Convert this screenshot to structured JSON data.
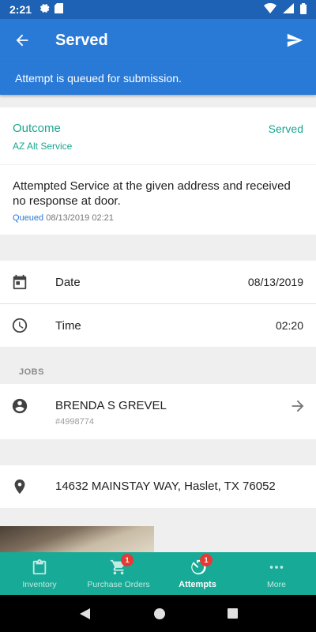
{
  "status_bar": {
    "time": "2:21"
  },
  "app_bar": {
    "title": "Served"
  },
  "banner": {
    "text": "Attempt is queued for submission."
  },
  "outcome": {
    "label": "Outcome",
    "sub": "AZ Alt Service",
    "value": "Served"
  },
  "description": {
    "text": "Attempted Service at the given address and received no response at door.",
    "status": "Queued",
    "timestamp": "08/13/2019 02:21"
  },
  "date_row": {
    "label": "Date",
    "value": "08/13/2019"
  },
  "time_row": {
    "label": "Time",
    "value": "02:20"
  },
  "jobs": {
    "header": "JOBS",
    "name": "BRENDA S GREVEL",
    "id": "#4998774"
  },
  "address": {
    "text": "14632 MAINSTAY WAY, Haslet, TX 76052"
  },
  "bottom_nav": {
    "items": [
      {
        "label": "Inventory",
        "icon": "clipboard-icon"
      },
      {
        "label": "Purchase Orders",
        "icon": "cart-icon",
        "badge": "1"
      },
      {
        "label": "Attempts",
        "icon": "timer-icon",
        "badge": "1",
        "active": true
      },
      {
        "label": "More",
        "icon": "more-icon"
      }
    ]
  },
  "colors": {
    "primary": "#2979d6",
    "status_bar": "#1d62b4",
    "accent": "#1aa590",
    "nav": "#17aa96",
    "badge": "#e53935"
  }
}
